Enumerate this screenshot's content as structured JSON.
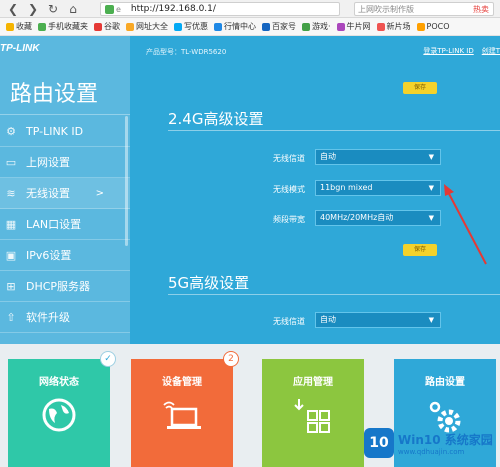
{
  "browser": {
    "url": "http://192.168.0.1/",
    "url_prefix": "e",
    "search_hint": "上网吹示制作版",
    "hot_sale": "热卖"
  },
  "bookmarks": [
    {
      "label": "收藏",
      "color": "#f5b400"
    },
    {
      "label": "手机收藏夹",
      "color": "#4caf50"
    },
    {
      "label": "谷歌",
      "color": "#e53935"
    },
    {
      "label": "网址大全",
      "color": "#f9a825"
    },
    {
      "label": "写优惠",
      "color": "#03a9f4"
    },
    {
      "label": "行情中心",
      "color": "#1e88e5"
    },
    {
      "label": "百家号",
      "color": "#1565c0"
    },
    {
      "label": "游戏·",
      "color": "#43a047"
    },
    {
      "label": "牛片网",
      "color": "#ab47bc"
    },
    {
      "label": "新片场",
      "color": "#ef5350"
    },
    {
      "label": "POCO",
      "color": "#ffa000"
    }
  ],
  "router": {
    "logo": "TP-LINK",
    "model": "产品型号：TL-WDR5620",
    "login_link": "登录TP-LINK ID",
    "create_link": "创建T",
    "sidebar_title": "路由设置",
    "sidebar": [
      {
        "label": "TP-LINK ID",
        "icon": "gear-icon",
        "glyph": "⚙",
        "active": false
      },
      {
        "label": "上网设置",
        "icon": "internet-icon",
        "glyph": "▭",
        "active": false
      },
      {
        "label": "无线设置",
        "icon": "wifi-icon",
        "glyph": "≋",
        "active": true,
        "arrow": ">"
      },
      {
        "label": "LAN口设置",
        "icon": "lan-icon",
        "glyph": "▦",
        "active": false
      },
      {
        "label": "IPv6设置",
        "icon": "ipv6-icon",
        "glyph": "▣",
        "active": false
      },
      {
        "label": "DHCP服务器",
        "icon": "dhcp-icon",
        "glyph": "⊞",
        "active": false
      },
      {
        "label": "软件升级",
        "icon": "upgrade-icon",
        "glyph": "⇧",
        "active": false
      }
    ],
    "save_label": "保存",
    "section_24": {
      "title": "2.4G高级设置",
      "rows": [
        {
          "label": "无线信道",
          "value": "自动"
        },
        {
          "label": "无线模式",
          "value": "11bgn mixed"
        },
        {
          "label": "频段带宽",
          "value": "40MHz/20MHz自动"
        }
      ]
    },
    "section_5": {
      "title": "5G高级设置",
      "rows": [
        {
          "label": "无线信道",
          "value": "自动"
        }
      ]
    }
  },
  "tiles": [
    {
      "label": "网络状态",
      "color": "#2fc8a8",
      "icon": "globe-icon",
      "badge": "✓"
    },
    {
      "label": "设备管理",
      "color": "#f26b3a",
      "icon": "laptop-wifi-icon",
      "badge": "2"
    },
    {
      "label": "应用管理",
      "color": "#8cc63f",
      "icon": "apps-icon",
      "badge": ""
    },
    {
      "label": "路由设置",
      "color": "#2fa8d8",
      "icon": "settings-gear-icon",
      "badge": ""
    }
  ],
  "watermark": {
    "logo": "10",
    "title": "Win10 系统家园",
    "url": "www.qdhuajin.com"
  },
  "accent": "#2fa8d8",
  "save_color": "#f4d22b",
  "annotation_arrow_color": "#e53935"
}
